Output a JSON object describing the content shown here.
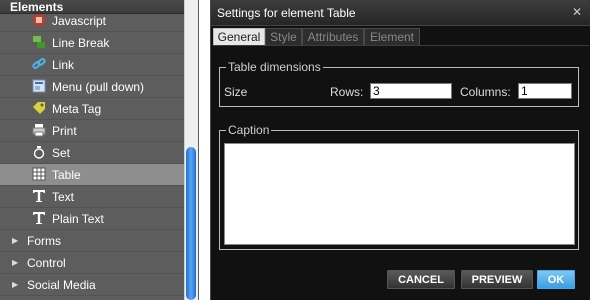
{
  "panel": {
    "header": "Elements",
    "items": [
      {
        "label": "Javascript",
        "icon": "javascript-icon",
        "selected": false
      },
      {
        "label": "Line Break",
        "icon": "line-break-icon",
        "selected": false
      },
      {
        "label": "Link",
        "icon": "link-icon",
        "selected": false
      },
      {
        "label": "Menu (pull down)",
        "icon": "menu-icon",
        "selected": false
      },
      {
        "label": "Meta Tag",
        "icon": "tag-icon",
        "selected": false
      },
      {
        "label": "Print",
        "icon": "print-icon",
        "selected": false
      },
      {
        "label": "Set",
        "icon": "set-icon",
        "selected": false
      },
      {
        "label": "Table",
        "icon": "table-icon",
        "selected": true
      },
      {
        "label": "Text",
        "icon": "text-icon",
        "selected": false
      },
      {
        "label": "Plain Text",
        "icon": "text-icon",
        "selected": false
      }
    ],
    "categories": [
      {
        "label": "Forms",
        "icon": "expand-arrow-icon"
      },
      {
        "label": "Control",
        "icon": "expand-arrow-icon"
      },
      {
        "label": "Social Media",
        "icon": "expand-arrow-icon"
      }
    ]
  },
  "dialog": {
    "title": "Settings for element Table",
    "close_icon": "close-icon",
    "tabs": [
      {
        "label": "General",
        "active": true
      },
      {
        "label": "Style",
        "active": false
      },
      {
        "label": "Attributes",
        "active": false
      },
      {
        "label": "Element",
        "active": false
      }
    ],
    "dimensions": {
      "legend": "Table dimensions",
      "size_label": "Size",
      "rows_label": "Rows:",
      "rows_value": "3",
      "columns_label": "Columns:",
      "columns_value": "1"
    },
    "caption": {
      "legend": "Caption",
      "value": ""
    },
    "buttons": {
      "cancel": "CANCEL",
      "preview": "PREVIEW",
      "ok": "OK"
    }
  }
}
